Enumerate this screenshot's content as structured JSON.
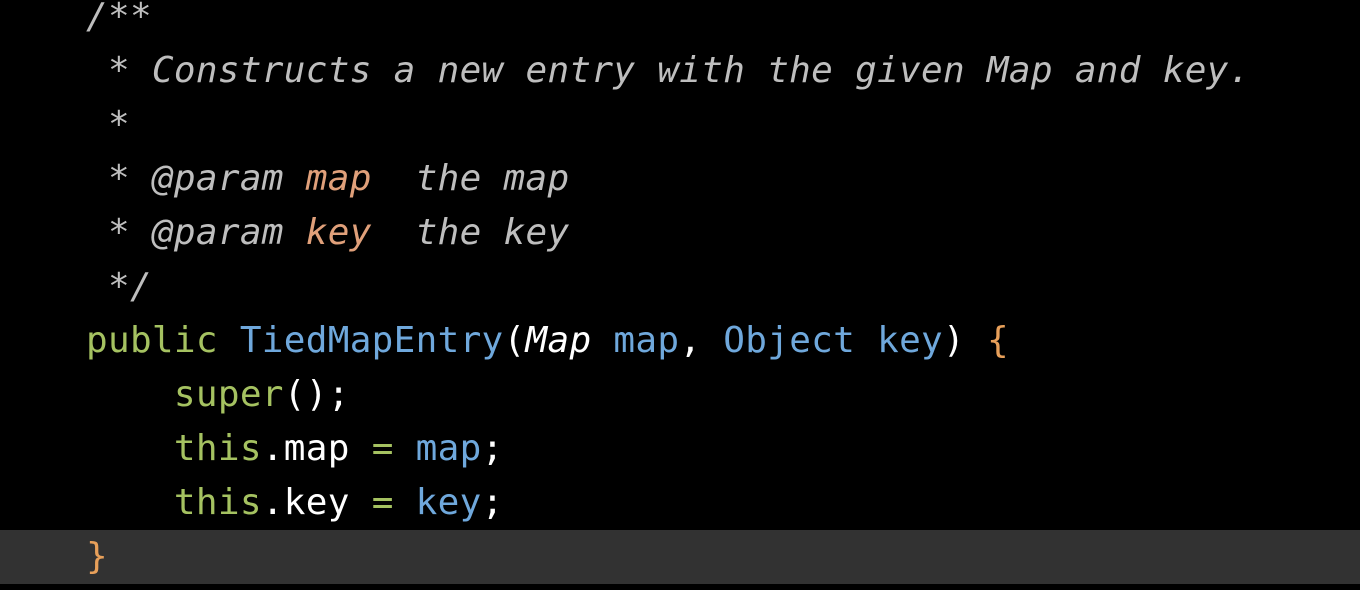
{
  "editor": {
    "lines": [
      {
        "indent": "",
        "tokens": [
          {
            "t": "/**",
            "c": "comment"
          }
        ]
      },
      {
        "indent": " ",
        "tokens": [
          {
            "t": "* Constructs a new entry with the given Map and key.",
            "c": "comment"
          }
        ]
      },
      {
        "indent": " ",
        "tokens": [
          {
            "t": "*",
            "c": "comment"
          }
        ]
      },
      {
        "indent": " ",
        "tokens": [
          {
            "t": "* @param ",
            "c": "comment"
          },
          {
            "t": "map",
            "c": "doc-param"
          },
          {
            "t": "  the map",
            "c": "comment"
          }
        ]
      },
      {
        "indent": " ",
        "tokens": [
          {
            "t": "* @param ",
            "c": "comment"
          },
          {
            "t": "key",
            "c": "doc-param"
          },
          {
            "t": "  the key",
            "c": "comment"
          }
        ]
      },
      {
        "indent": " ",
        "tokens": [
          {
            "t": "*/",
            "c": "comment"
          }
        ]
      },
      {
        "indent": "",
        "tokens": [
          {
            "t": "public",
            "c": "keyword"
          },
          {
            "t": " ",
            "c": "punct"
          },
          {
            "t": "TiedMapEntry",
            "c": "func"
          },
          {
            "t": "(",
            "c": "punct"
          },
          {
            "t": "Map",
            "c": "type-italic"
          },
          {
            "t": " ",
            "c": "punct"
          },
          {
            "t": "map",
            "c": "param"
          },
          {
            "t": ", ",
            "c": "punct"
          },
          {
            "t": "Object",
            "c": "type"
          },
          {
            "t": " ",
            "c": "punct"
          },
          {
            "t": "key",
            "c": "param"
          },
          {
            "t": ") ",
            "c": "punct"
          },
          {
            "t": "{",
            "c": "brace"
          }
        ]
      },
      {
        "indent": "    ",
        "tokens": [
          {
            "t": "super",
            "c": "keyword"
          },
          {
            "t": "();",
            "c": "punct"
          }
        ]
      },
      {
        "indent": "    ",
        "tokens": [
          {
            "t": "this",
            "c": "keyword"
          },
          {
            "t": ".map ",
            "c": "ident"
          },
          {
            "t": "=",
            "c": "op"
          },
          {
            "t": " ",
            "c": "punct"
          },
          {
            "t": "map",
            "c": "param"
          },
          {
            "t": ";",
            "c": "punct"
          }
        ]
      },
      {
        "indent": "    ",
        "tokens": [
          {
            "t": "this",
            "c": "keyword"
          },
          {
            "t": ".key ",
            "c": "ident"
          },
          {
            "t": "=",
            "c": "op"
          },
          {
            "t": " ",
            "c": "punct"
          },
          {
            "t": "key",
            "c": "param"
          },
          {
            "t": ";",
            "c": "punct"
          }
        ]
      },
      {
        "indent": "",
        "current": true,
        "tokens": [
          {
            "t": "}",
            "c": "brace"
          }
        ]
      }
    ]
  },
  "colors": {
    "background": "#000000",
    "current_line": "#323232",
    "comment": "#bebebe",
    "doc_param": "#e0a07a",
    "keyword": "#a5c261",
    "function": "#6fa8dc",
    "brace": "#e8a05a"
  }
}
